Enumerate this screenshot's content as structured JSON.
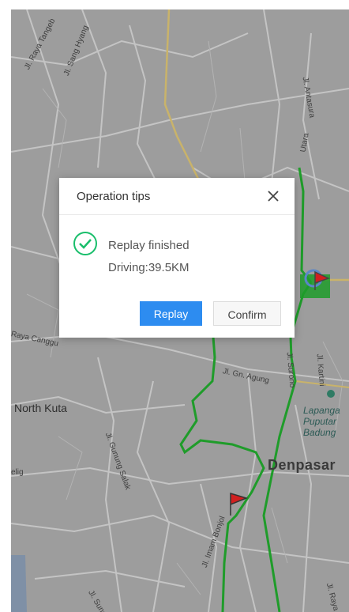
{
  "map": {
    "labels": {
      "jl_raya_tangeb": "Jl. Raya Tangeb",
      "jl_sang_hyang": "Jl. Sang Hyang",
      "jl_antasura": "Jl. Antasura",
      "utara": "Utara",
      "raya_canggu": "Raya Canggu",
      "jl_gn_agung": "Jl. Gn. Agung",
      "jl_kartini": "Jl. Kartini",
      "jl_surono": "Jl. Surono",
      "north_kuta": "North Kuta",
      "jl_gunung_salak": "Jl. Gunung Salak",
      "denpasar": "Denpasar",
      "lapangan_1": "Lapanga",
      "lapangan_2": "Puputar",
      "lapangan_3": "Badung",
      "elig": "elig",
      "jl_imam_bonjol": "Jl. Imam Bonjol",
      "jl_sunset": "Jl. Sunset",
      "jl_raya_s": "Jl. Raya S"
    },
    "route_color": "#1f9c2a",
    "flag_color": "#d11f1f"
  },
  "dialog": {
    "title": "Operation tips",
    "message": "Replay finished",
    "detail": "Driving:39.5KM",
    "replay_label": "Replay",
    "confirm_label": "Confirm",
    "success_color": "#19be6b",
    "primary_color": "#2d8cf0"
  }
}
